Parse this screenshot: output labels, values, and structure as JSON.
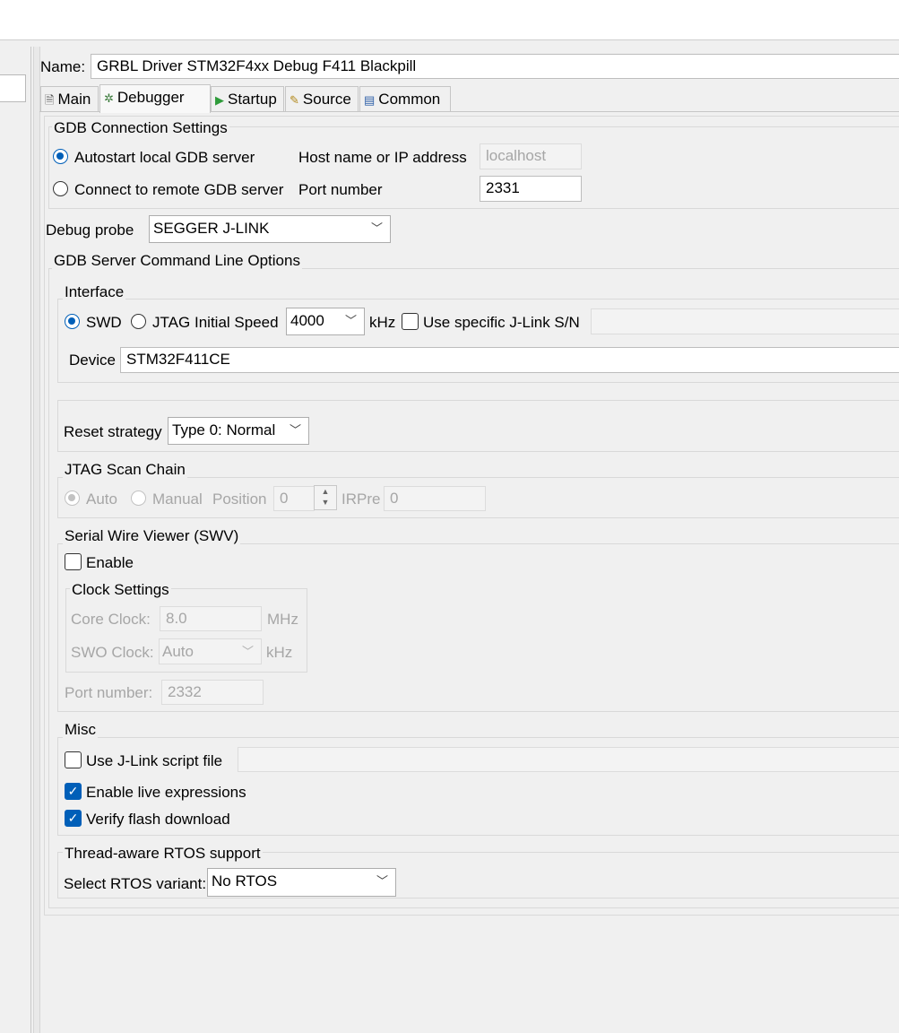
{
  "name": {
    "label": "Name:",
    "value": "GRBL Driver STM32F4xx Debug F411 Blackpill"
  },
  "tabs": [
    {
      "label": "Main",
      "icon": "document-icon"
    },
    {
      "label": "Debugger",
      "icon": "bug-icon"
    },
    {
      "label": "Startup",
      "icon": "play-icon"
    },
    {
      "label": "Source",
      "icon": "source-icon"
    },
    {
      "label": "Common",
      "icon": "window-icon"
    }
  ],
  "gdb_connection": {
    "title": "GDB Connection Settings",
    "autostart_label": "Autostart local GDB server",
    "remote_label": "Connect to remote GDB server",
    "host_label": "Host name or IP address",
    "host_value": "localhost",
    "port_label": "Port number",
    "port_value": "2331"
  },
  "debug_probe": {
    "label": "Debug probe",
    "value": "SEGGER J-LINK"
  },
  "server_options": {
    "title": "GDB Server Command Line Options",
    "interface": {
      "title": "Interface",
      "swd": "SWD",
      "jtag": "JTAG",
      "speed_label": "Initial Speed",
      "speed_value": "4000",
      "speed_unit": "kHz",
      "sn_label": "Use specific J-Link S/N",
      "device_label": "Device",
      "device_value": "STM32F411CE"
    },
    "reset": {
      "label": "Reset strategy",
      "value": "Type 0: Normal"
    },
    "jtag_chain": {
      "title": "JTAG Scan Chain",
      "auto": "Auto",
      "manual": "Manual",
      "position_label": "Position",
      "position_value": "0",
      "irpre_label": "IRPre",
      "irpre_value": "0"
    },
    "swv": {
      "title": "Serial Wire Viewer (SWV)",
      "enable_label": "Enable",
      "clock_title": "Clock Settings",
      "core_clock_label": "Core Clock:",
      "core_clock_value": "8.0",
      "core_clock_unit": "MHz",
      "swo_clock_label": "SWO Clock:",
      "swo_clock_value": "Auto",
      "swo_clock_unit": "kHz",
      "port_label": "Port number:",
      "port_value": "2332"
    },
    "misc": {
      "title": "Misc",
      "script_label": "Use J-Link script file",
      "live_expr_label": "Enable live expressions",
      "verify_label": "Verify flash download"
    },
    "rtos": {
      "title": "Thread-aware RTOS support",
      "variant_label": "Select RTOS variant:",
      "variant_value": "No RTOS"
    }
  },
  "colors": {
    "accent": "#005fb8",
    "background": "#f0f0f0",
    "disabled_text": "#a6a6a6"
  }
}
